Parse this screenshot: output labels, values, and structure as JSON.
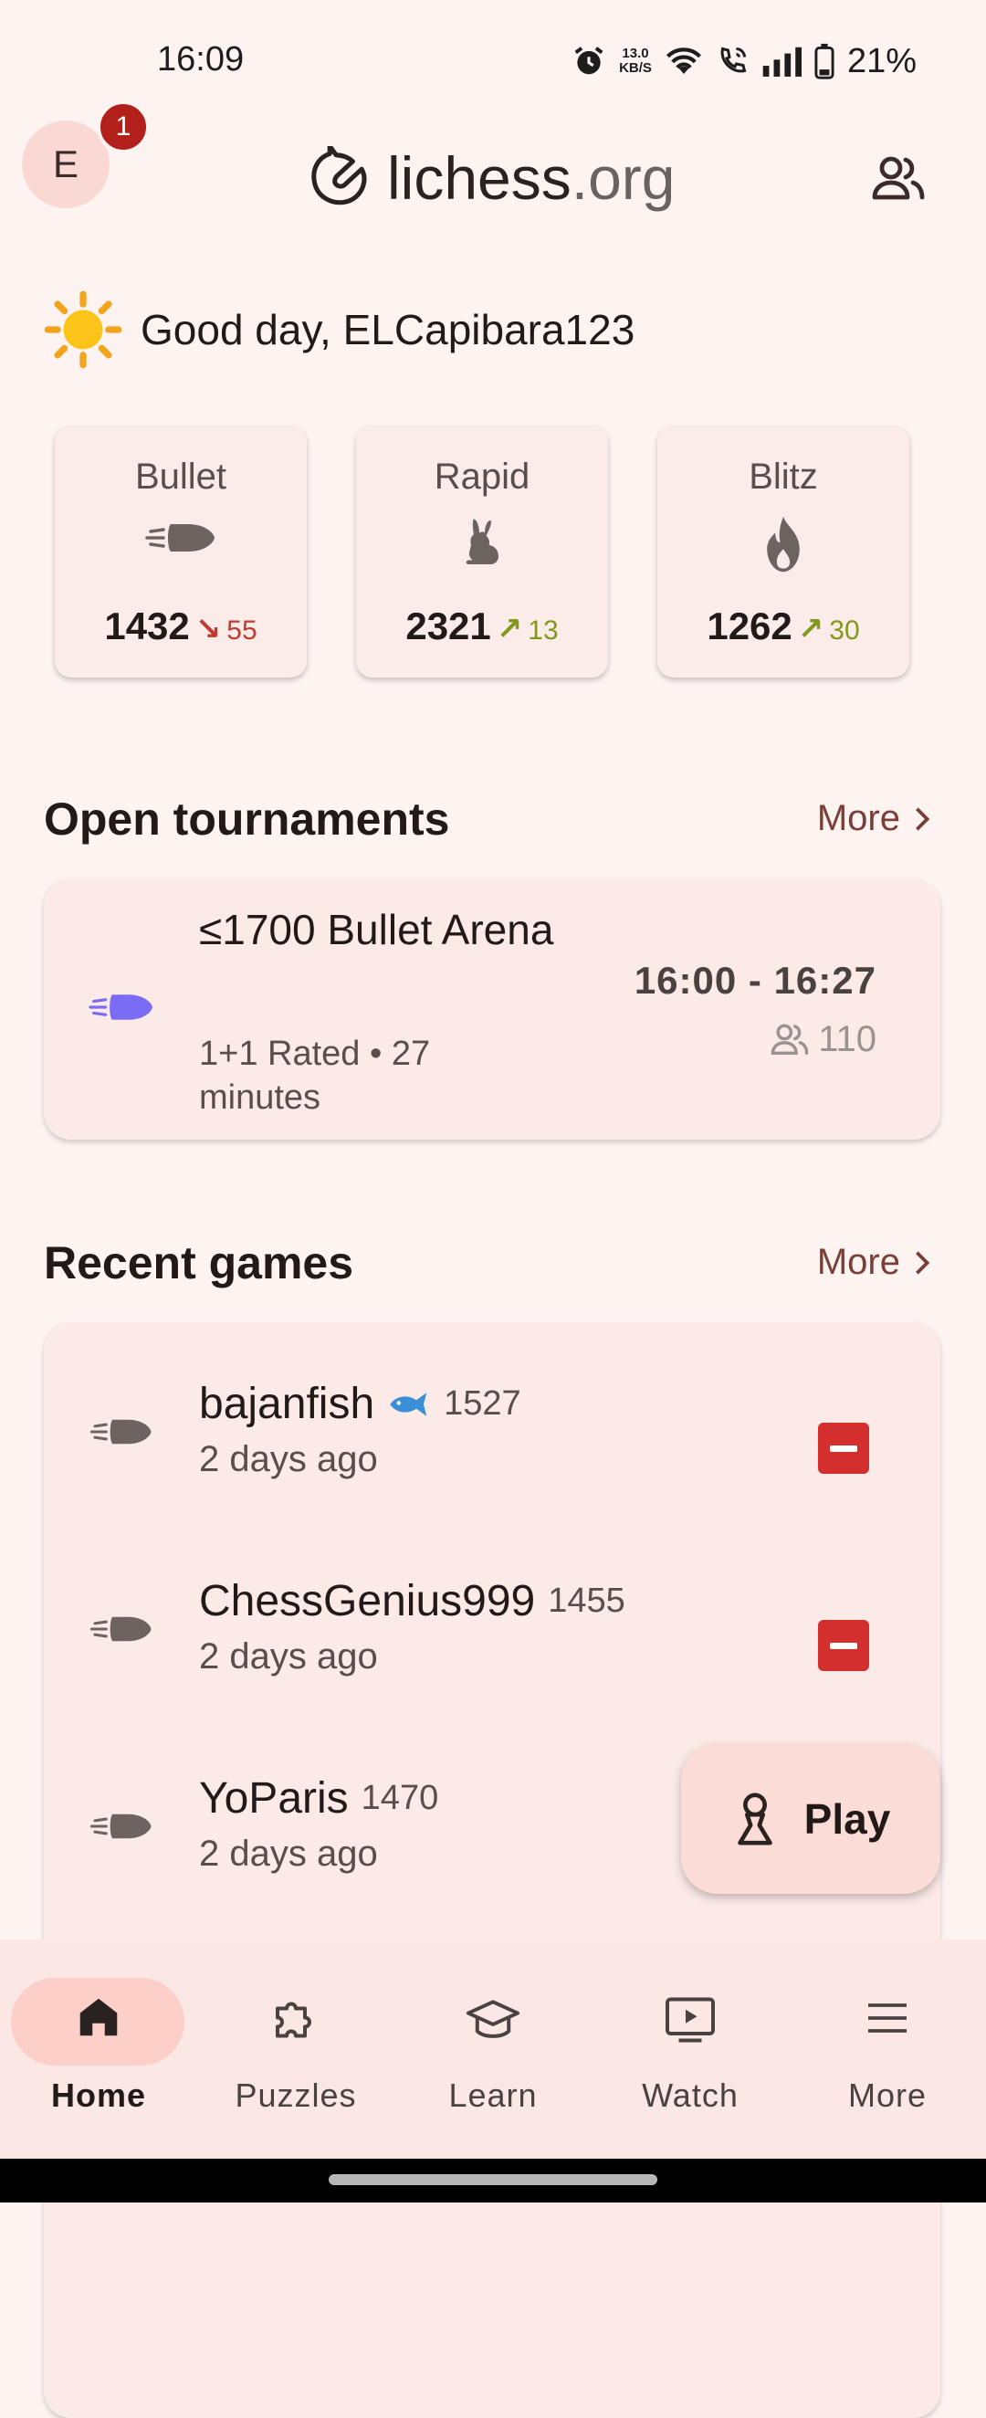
{
  "status_bar": {
    "time": "16:09",
    "net_speed_value": "13.0",
    "net_speed_unit": "KB/S",
    "battery": "21%",
    "icons": [
      "alarm-icon",
      "wifi-icon",
      "call-icon",
      "signal-icon",
      "battery-icon"
    ]
  },
  "header": {
    "avatar_letter": "E",
    "notification_count": "1",
    "logo_main": "lichess",
    "logo_suffix": ".org",
    "friends_icon": "friends-icon"
  },
  "greeting": {
    "icon": "sun-icon",
    "text": "Good day, ELCapibara123"
  },
  "ratings": [
    {
      "name": "Bullet",
      "icon": "bullet-icon",
      "rating": "1432",
      "trend": "down",
      "delta": "55"
    },
    {
      "name": "Rapid",
      "icon": "rabbit-icon",
      "rating": "2321",
      "trend": "up",
      "delta": "13"
    },
    {
      "name": "Blitz",
      "icon": "flame-icon",
      "rating": "1262",
      "trend": "up",
      "delta": "30"
    }
  ],
  "tournaments": {
    "title": "Open tournaments",
    "more_label": "More",
    "items": [
      {
        "name": "≤1700 Bullet Arena",
        "details": "1+1 Rated • 27 minutes",
        "time_range": "16:00 - 16:27",
        "players": "110",
        "icon": "bullet-icon"
      }
    ]
  },
  "recent_games": {
    "title": "Recent games",
    "more_label": "More",
    "items": [
      {
        "opponent": "bajanfish",
        "opponent_icon": "fish-icon",
        "rating": "1527",
        "when": "2 days ago",
        "result": "loss"
      },
      {
        "opponent": "ChessGenius999",
        "rating": "1455",
        "when": "2 days ago",
        "result": "loss"
      },
      {
        "opponent": "YoParis",
        "rating": "1470",
        "when": "2 days ago",
        "result": ""
      }
    ]
  },
  "fab": {
    "label": "Play",
    "icon": "pawn-icon"
  },
  "bottom_nav": {
    "active": "Home",
    "items": [
      {
        "label": "Home",
        "icon": "home-icon"
      },
      {
        "label": "Puzzles",
        "icon": "puzzle-icon"
      },
      {
        "label": "Learn",
        "icon": "graduation-cap-icon"
      },
      {
        "label": "Watch",
        "icon": "tv-icon"
      },
      {
        "label": "More",
        "icon": "menu-icon"
      }
    ]
  },
  "colors": {
    "background": "#fdf4f2",
    "accent": "#7a3e38",
    "loss": "#d32f2f",
    "trend_up": "#7f9a1a",
    "trend_down": "#c23b32",
    "tournament_icon": "#7b6cf6"
  }
}
